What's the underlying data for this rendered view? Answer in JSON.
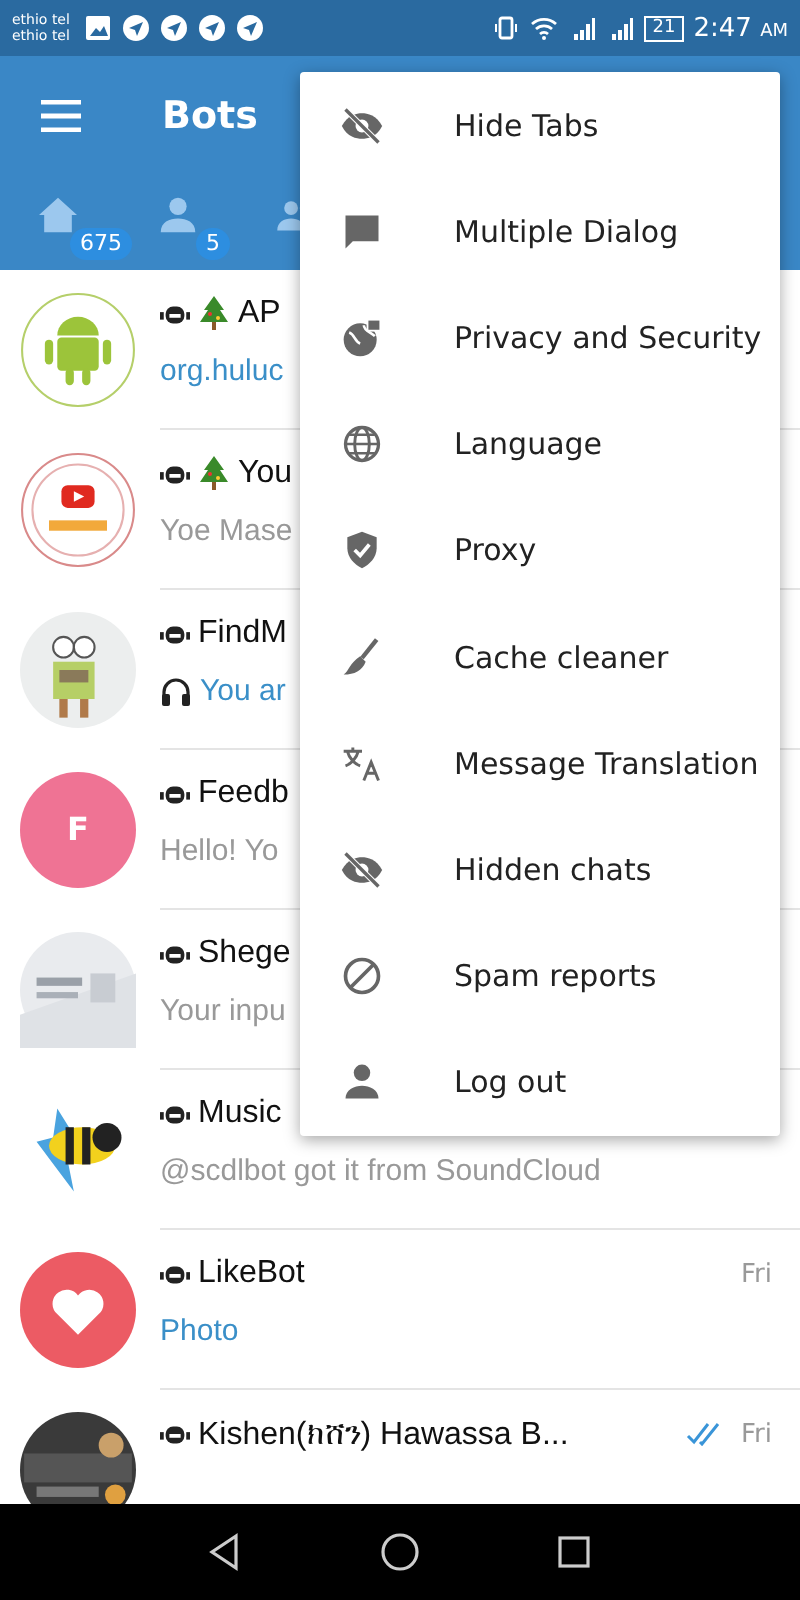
{
  "status_bar": {
    "carriers": [
      "ethio tel",
      "ethio tel"
    ],
    "battery": "21",
    "time": "2:47",
    "ampm": "AM"
  },
  "header": {
    "title": "Bots"
  },
  "tabs": [
    {
      "kind": "home",
      "badge": "675"
    },
    {
      "kind": "person",
      "badge": "5"
    },
    {
      "kind": "group"
    }
  ],
  "chats": [
    {
      "kind": "picture",
      "tree": true,
      "name": "AP",
      "message": "org.huluc",
      "highlight": true
    },
    {
      "kind": "picture",
      "tree": true,
      "name": "You",
      "message": "Yoe Mase",
      "highlight": false
    },
    {
      "kind": "picture",
      "tree": false,
      "name": "FindM",
      "message": "You ar",
      "highlight": true,
      "headphones": true
    },
    {
      "kind": "letter",
      "letter": "F",
      "color": "#ef7394",
      "tree": false,
      "name": "Feedb",
      "message": "Hello!  Yo",
      "highlight": false
    },
    {
      "kind": "picture",
      "tree": false,
      "name": "Shege",
      "message": "Your inpu",
      "highlight": false
    },
    {
      "kind": "picture",
      "tree": false,
      "name": "Music",
      "message": "@scdlbot got it from SoundCloud",
      "highlight": false
    },
    {
      "kind": "heart",
      "color": "#ec5b64",
      "tree": false,
      "name": "LikeBot",
      "message": "Photo",
      "highlight": true,
      "time": "Fri"
    },
    {
      "kind": "picture",
      "tree": false,
      "name": "Kishen(ክሸን) Hawassa B...",
      "time": "Fri",
      "read": true
    }
  ],
  "menu": [
    {
      "label": "Hide Tabs"
    },
    {
      "label": "Multiple Dialog"
    },
    {
      "label": "Privacy and Security"
    },
    {
      "label": "Language"
    },
    {
      "label": "Proxy"
    },
    {
      "label": "Cache cleaner"
    },
    {
      "label": "Message Translation"
    },
    {
      "label": "Hidden chats"
    },
    {
      "label": "Spam reports"
    },
    {
      "label": "Log out"
    }
  ]
}
